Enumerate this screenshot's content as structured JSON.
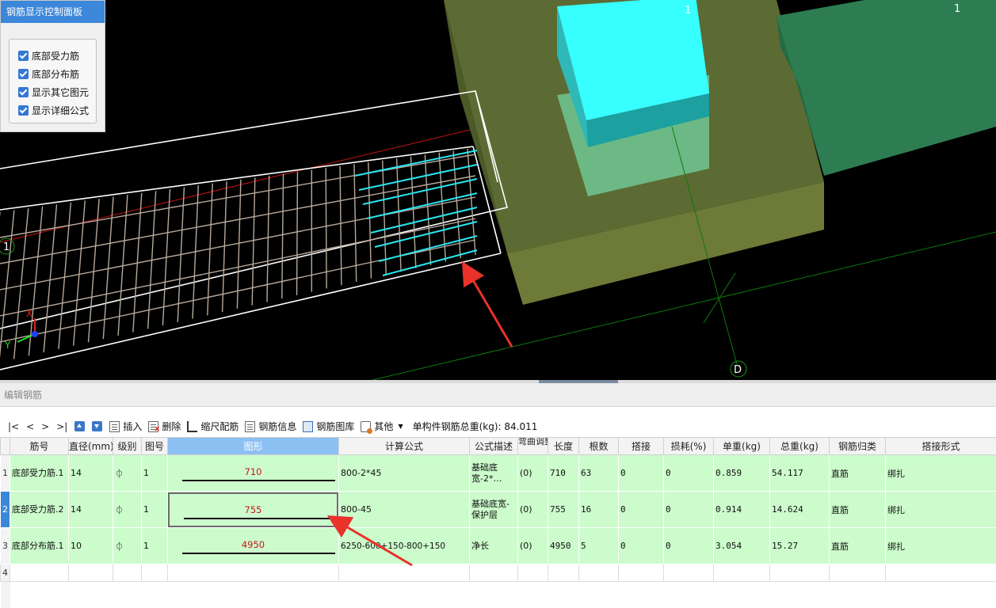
{
  "viewport": {
    "axis_labels": {
      "x": "X",
      "y": "Y"
    },
    "grid_labels": [
      "1",
      "1",
      "1",
      "D"
    ]
  },
  "control_panel": {
    "title": "钢筋显示控制面板",
    "options": [
      {
        "label": "底部受力筋",
        "checked": true
      },
      {
        "label": "底部分布筋",
        "checked": true
      },
      {
        "label": "显示其它图元",
        "checked": true
      },
      {
        "label": "显示详细公式",
        "checked": true
      }
    ]
  },
  "editor": {
    "title": "编辑钢筋",
    "toolbar": {
      "nav_first": "|<",
      "nav_prev": "<",
      "nav_next": ">",
      "nav_last": ">|",
      "insert": "插入",
      "delete": "删除",
      "scale_rebar": "缩尺配筋",
      "rebar_info": "钢筋信息",
      "rebar_library": "钢筋图库",
      "other": "其他",
      "total_label": "单构件钢筋总重(kg): 84.011"
    },
    "columns": [
      "筋号",
      "直径(mm)",
      "级别",
      "图号",
      "图形",
      "计算公式",
      "公式描述",
      "弯曲调整",
      "长度",
      "根数",
      "搭接",
      "损耗(%)",
      "单重(kg)",
      "总重(kg)",
      "钢筋归类",
      "搭接形式"
    ],
    "rows": [
      {
        "no": "1",
        "name": "底部受力筋.1",
        "diameter": "14",
        "grade": "⏀",
        "fig": "1",
        "shape": "710",
        "formula": "800-2*45",
        "desc": "基础底宽-2*…",
        "bend": "(0)",
        "length": "710",
        "count": "63",
        "lap": "0",
        "loss": "0",
        "unit_w": "0.859",
        "total_w": "54.117",
        "category": "直筋",
        "lap_type": "绑扎"
      },
      {
        "no": "2",
        "name": "底部受力筋.2",
        "diameter": "14",
        "grade": "⏀",
        "fig": "1",
        "shape": "755",
        "formula": "800-45",
        "desc": "基础底宽-保护层",
        "bend": "(0)",
        "length": "755",
        "count": "16",
        "lap": "0",
        "loss": "0",
        "unit_w": "0.914",
        "total_w": "14.624",
        "category": "直筋",
        "lap_type": "绑扎"
      },
      {
        "no": "3",
        "name": "底部分布筋.1",
        "diameter": "10",
        "grade": "⏀",
        "fig": "1",
        "shape": "4950",
        "formula": "6250-600+150-800+150",
        "desc": "净长",
        "bend": "(0)",
        "length": "4950",
        "count": "5",
        "lap": "0",
        "loss": "0",
        "unit_w": "3.054",
        "total_w": "15.27",
        "category": "直筋",
        "lap_type": "绑扎"
      }
    ],
    "empty_row_no": "4"
  }
}
